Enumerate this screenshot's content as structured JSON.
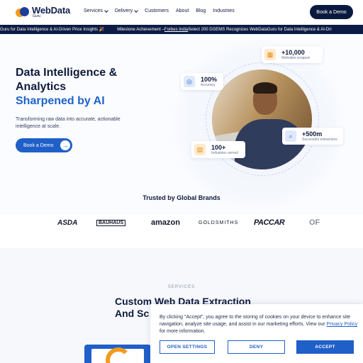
{
  "nav": {
    "logo_main": "WebData",
    "logo_sub": "Guru",
    "menu": [
      {
        "label": "Services",
        "dropdown": true
      },
      {
        "label": "Delivery",
        "dropdown": true
      },
      {
        "label": "Customers",
        "dropdown": false
      },
      {
        "label": "About",
        "dropdown": false
      },
      {
        "label": "Blog",
        "dropdown": false
      },
      {
        "label": "Industries",
        "dropdown": false
      }
    ],
    "cta": "Book a Demo"
  },
  "ticker": {
    "part1": "Guru for Data Intelligence & AI-Driven Price Insights 🎉",
    "part2": "Milestone Achievement – ",
    "link": "Forbes India",
    "part3": " Select 200 DGEMS Recognizes WebDataGuru for Data Intelligence & AI-Dri"
  },
  "hero": {
    "title_line1": "Data Intelligence &",
    "title_line2": "Analytics",
    "title_line3": "Sharpened by AI",
    "description": "Transforming raw data into accurate, actionable intelligence at scale.",
    "cta": "Book a Demo",
    "stats": [
      {
        "value": "+10,000",
        "label": "Websites scraped",
        "icon": "layout-icon"
      },
      {
        "value": "100%",
        "label": "Accuracy",
        "icon": "target-icon"
      },
      {
        "value": "+500m",
        "label": "Successful extractions",
        "icon": "search-icon"
      },
      {
        "value": "100+",
        "label": "Industries served",
        "icon": "chart-icon"
      }
    ]
  },
  "brands": {
    "heading": "Trusted by Global Brands",
    "items": [
      "ASDA",
      "BAUHAUS",
      "amazon",
      "GOLDSMITHS",
      "PACCAR",
      "OF"
    ]
  },
  "services": {
    "eyebrow": "SERVICES",
    "title_line1": "Custom Web Data Extraction",
    "title_line2": "And Sc"
  },
  "cookie": {
    "text_before": "By clicking \"Accept\", you agree to the storing of cookies on your device to enhance site navigation, analyze site usage, and assist in our marketing efforts. View our ",
    "link": "Privacy Policy",
    "text_after": " for more information.",
    "settings": "OPEN SETTINGS",
    "deny": "DENY",
    "accept": "ACCEPT"
  },
  "colors": {
    "navy": "#0a1a3f",
    "accent": "#1f5fc8",
    "orange": "#f39a1e"
  }
}
